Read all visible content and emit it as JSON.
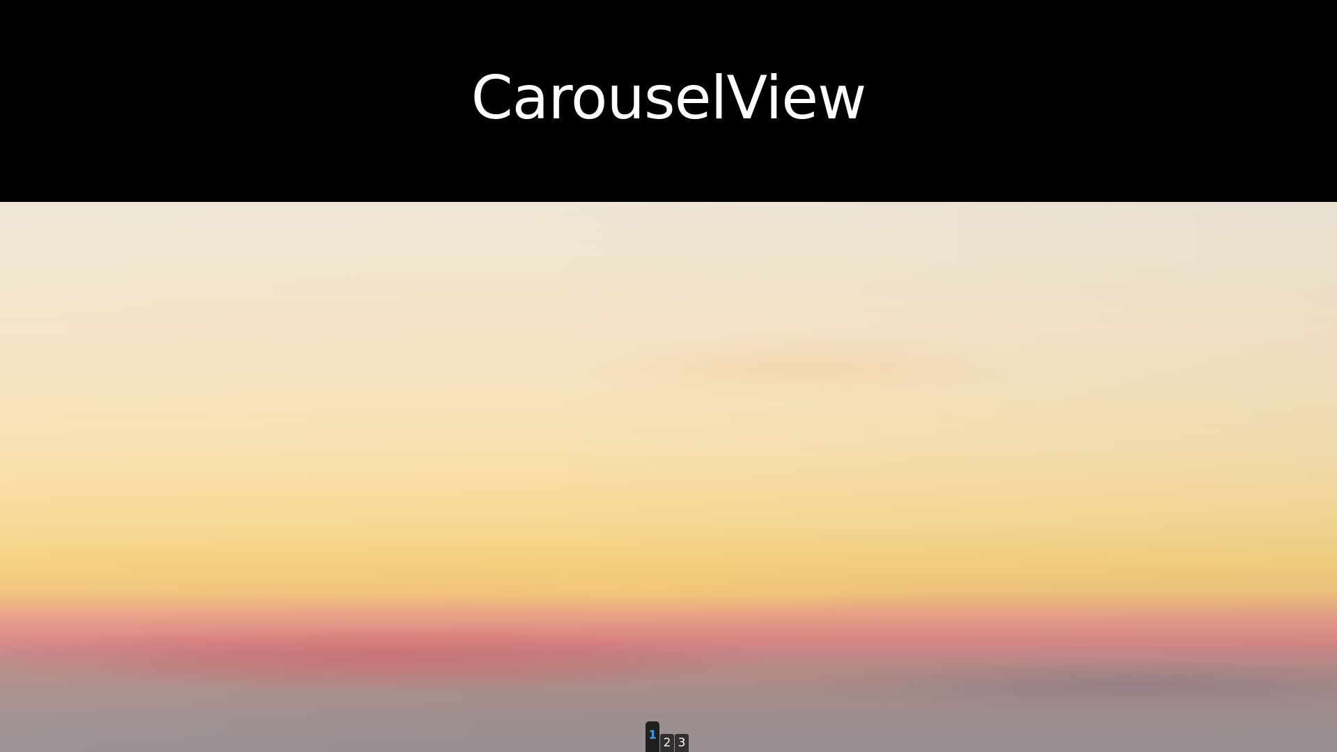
{
  "header": {
    "title": "CarouselView"
  },
  "carousel": {
    "current_index": 1,
    "indicators": [
      {
        "label": "1",
        "active": true
      },
      {
        "label": "2",
        "active": false
      },
      {
        "label": "3",
        "active": false
      }
    ]
  },
  "colors": {
    "header_background": "#000000",
    "title_color": "#ffffff",
    "active_indicator_color": "#3d9ae8",
    "indicator_background": "#141414"
  }
}
